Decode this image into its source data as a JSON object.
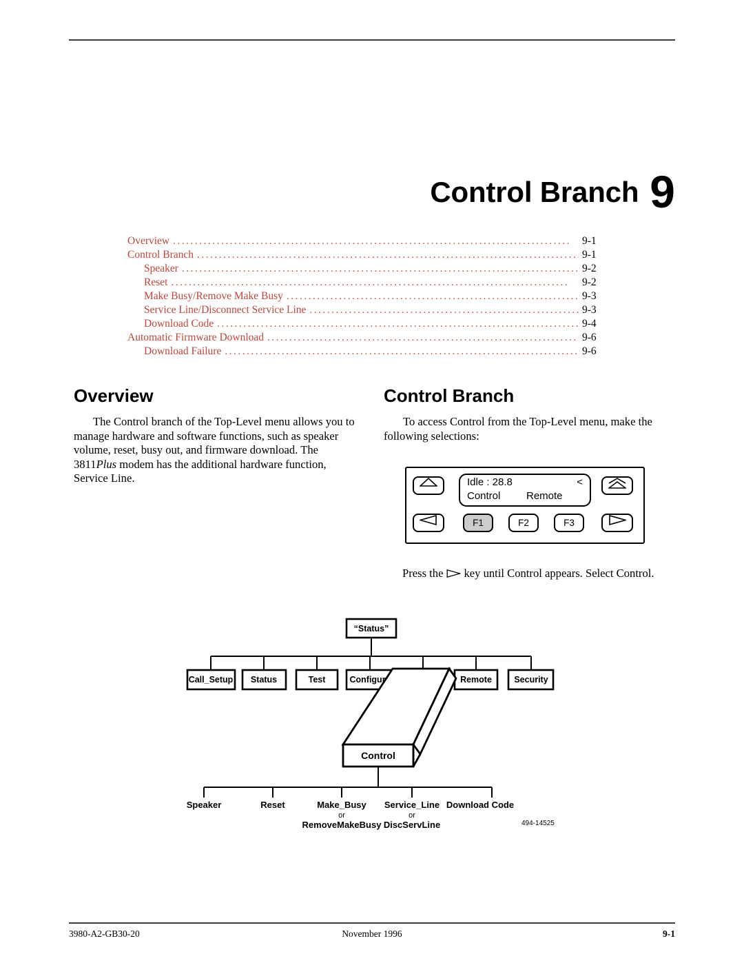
{
  "chapter": {
    "title": "Control Branch",
    "number": "9"
  },
  "toc": {
    "entries": [
      {
        "label": "Overview",
        "page": "9-1",
        "indent": 0
      },
      {
        "label": "Control Branch",
        "page": "9-1",
        "indent": 0
      },
      {
        "label": "Speaker",
        "page": "9-2",
        "indent": 1
      },
      {
        "label": "Reset",
        "page": "9-2",
        "indent": 1
      },
      {
        "label": "Make Busy/Remove Make Busy",
        "page": "9-3",
        "indent": 1
      },
      {
        "label": "Service Line/Disconnect Service Line",
        "page": "9-3",
        "indent": 1
      },
      {
        "label": "Download Code",
        "page": "9-4",
        "indent": 1
      },
      {
        "label": "Automatic Firmware Download",
        "page": "9-6",
        "indent": 0
      },
      {
        "label": "Download Failure",
        "page": "9-6",
        "indent": 1
      }
    ],
    "dot_color": "#C0453A",
    "text_color": "#C0453A",
    "page_color": "#000000"
  },
  "sections": {
    "overview": {
      "heading": "Overview",
      "paragraph_part1": "The Control branch of the Top-Level menu allows you to manage hardware and software functions, such as speaker volume, reset, busy out, and firmware download. The 3811",
      "paragraph_italic": "Plus",
      "paragraph_part2": " modem has the additional hardware function, Service Line."
    },
    "control_branch": {
      "heading": "Control Branch",
      "paragraph": "To access Control from the Top-Level menu, make the following selections:",
      "press_prefix": "Press the",
      "press_suffix": "key until Control appears. Select Control."
    }
  },
  "keypad": {
    "lcd": {
      "line1_left": "Idle : 28.8",
      "line1_right": "<",
      "line2_left": "Control",
      "line2_mid": "Remote"
    },
    "keys": [
      {
        "id": "key-up",
        "label": "",
        "icon": "triangle-up-icon",
        "active": false
      },
      {
        "id": "key-updouble",
        "label": "",
        "icon": "double-triangle-up-icon",
        "active": false
      },
      {
        "id": "key-left",
        "label": "",
        "icon": "triangle-left-icon",
        "active": false
      },
      {
        "id": "key-right",
        "label": "",
        "icon": "triangle-right-icon",
        "active": false
      },
      {
        "id": "key-f1",
        "label": "F1",
        "icon": "",
        "active": true
      },
      {
        "id": "key-f2",
        "label": "F2",
        "icon": "",
        "active": false
      },
      {
        "id": "key-f3",
        "label": "F3",
        "icon": "",
        "active": false
      }
    ]
  },
  "diagram": {
    "root": "“Status”",
    "menu_row": [
      "Call_Setup",
      "Status",
      "Test",
      "Configure",
      "Remote",
      "Security"
    ],
    "highlighted_box": "Control",
    "leaves": [
      {
        "line1": "Speaker",
        "or": "",
        "line2": ""
      },
      {
        "line1": "Reset",
        "or": "",
        "line2": ""
      },
      {
        "line1": "Make_Busy",
        "or": "or",
        "line2": "RemoveMakeBusy"
      },
      {
        "line1": "Service_Line",
        "or": "or",
        "line2": "DiscServLine"
      },
      {
        "line1": "Download Code",
        "or": "",
        "line2": ""
      }
    ],
    "figure_id": "494-14525"
  },
  "footer": {
    "left": "3980-A2-GB30-20",
    "center": "November 1996",
    "right": "9-1"
  }
}
